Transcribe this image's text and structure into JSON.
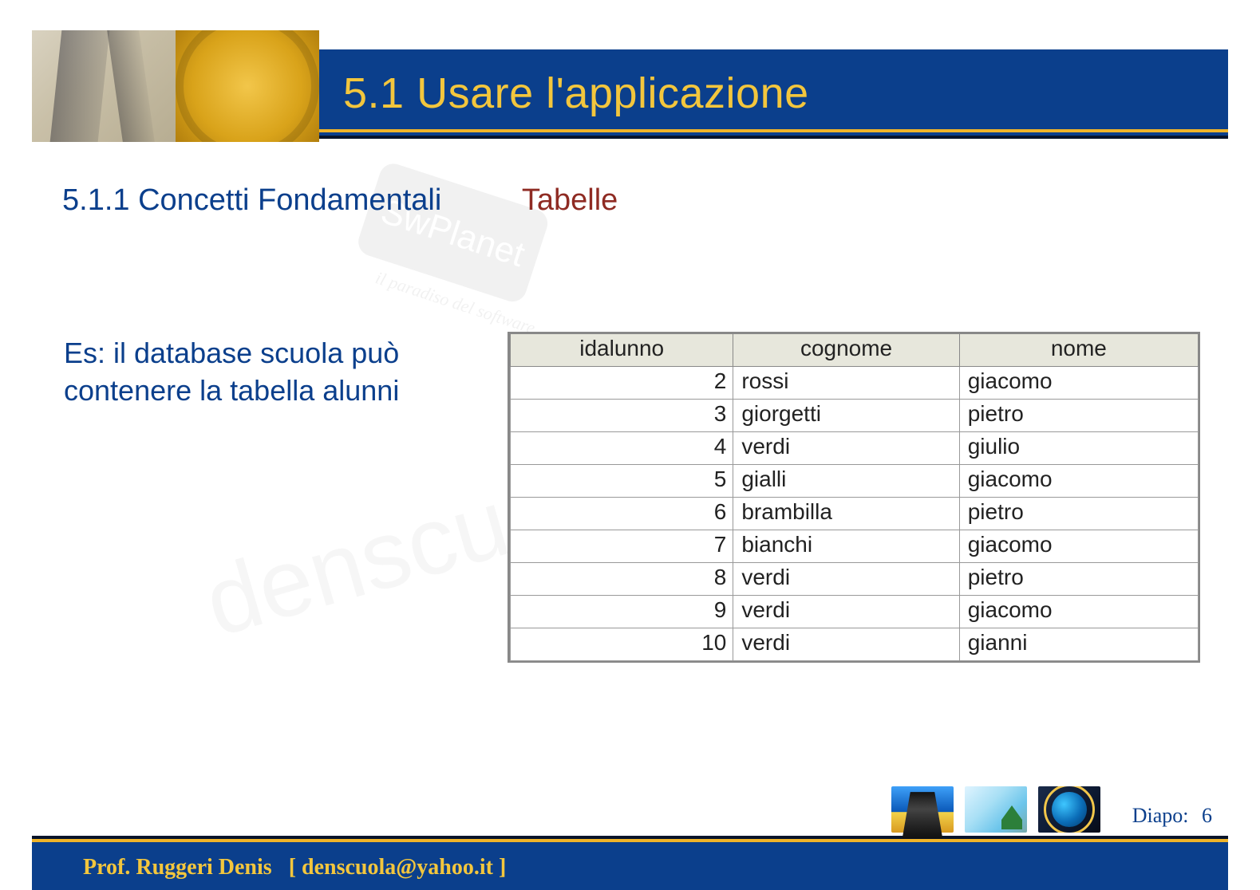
{
  "header": {
    "title": "5.1 Usare l'applicazione"
  },
  "subtitle": {
    "section": "5.1.1 Concetti Fondamentali",
    "topic": "Tabelle"
  },
  "body": {
    "text": "Es: il database scuola può contenere la tabella alunni"
  },
  "watermark": {
    "main": "denscuola@yahoo.it",
    "badge_label": "SwPlanet",
    "badge_tagline": "il paradiso del software"
  },
  "table": {
    "headers": [
      "idalunno",
      "cognome",
      "nome"
    ],
    "rows": [
      {
        "id": "2",
        "cognome": "rossi",
        "nome": "giacomo"
      },
      {
        "id": "3",
        "cognome": "giorgetti",
        "nome": "pietro"
      },
      {
        "id": "4",
        "cognome": "verdi",
        "nome": "giulio"
      },
      {
        "id": "5",
        "cognome": "gialli",
        "nome": "giacomo"
      },
      {
        "id": "6",
        "cognome": "brambilla",
        "nome": "pietro"
      },
      {
        "id": "7",
        "cognome": "bianchi",
        "nome": "giacomo"
      },
      {
        "id": "8",
        "cognome": "verdi",
        "nome": "pietro"
      },
      {
        "id": "9",
        "cognome": "verdi",
        "nome": "giacomo"
      },
      {
        "id": "10",
        "cognome": "verdi",
        "nome": "gianni"
      }
    ]
  },
  "footer": {
    "author": "Prof. Ruggeri Denis",
    "email": "denscuola@yahoo.it",
    "page_label": "Diapo:",
    "page_number": "6"
  }
}
